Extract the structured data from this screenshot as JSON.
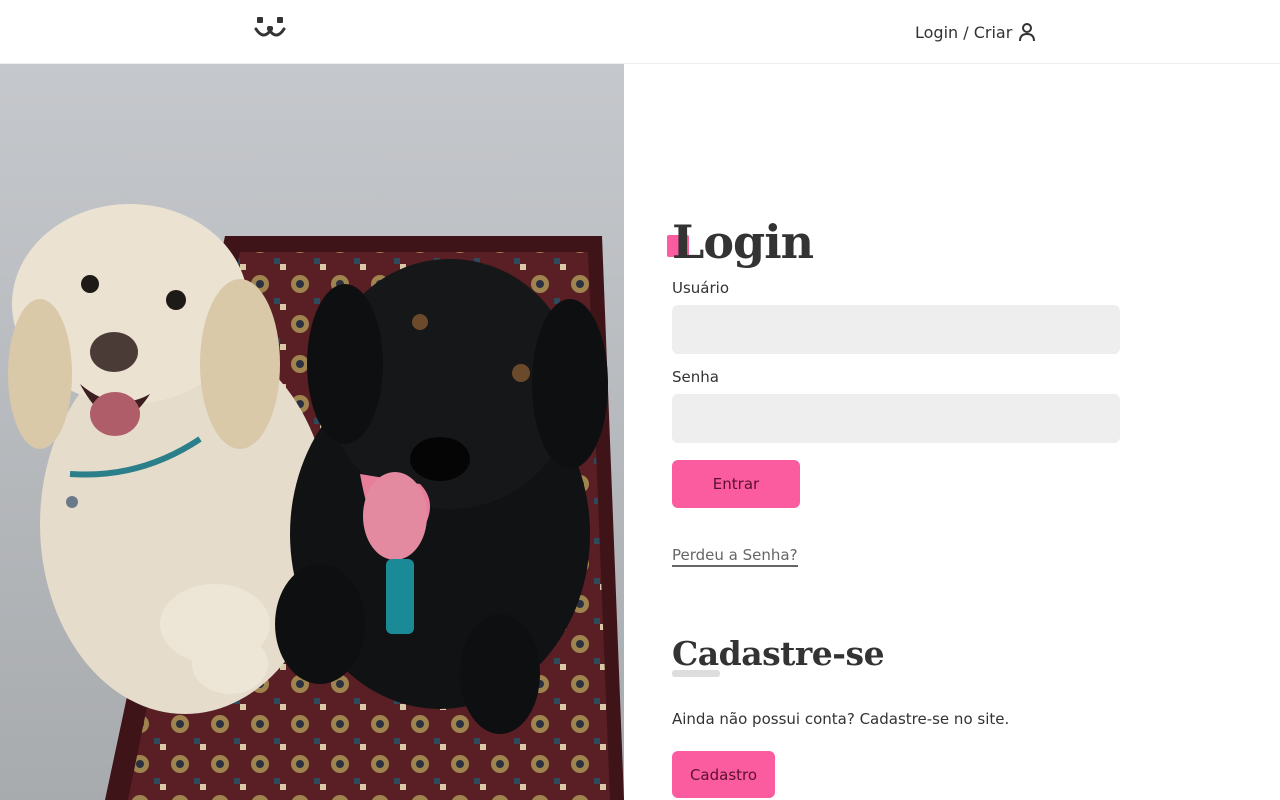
{
  "header": {
    "logo_icon": "dog-face-icon",
    "login_label": "Login / Criar",
    "login_icon": "user-icon"
  },
  "hero": {
    "image_icon": "two-dogs-photo"
  },
  "login": {
    "title": "Login",
    "username_label": "Usuário",
    "username_value": "",
    "password_label": "Senha",
    "password_value": "",
    "submit_label": "Entrar",
    "lost_password_label": "Perdeu a Senha?"
  },
  "signup": {
    "title": "Cadastre-se",
    "description": "Ainda não possui conta? Cadastre-se no site.",
    "button_label": "Cadastro"
  },
  "colors": {
    "accent": "#fb5c9f",
    "input_bg": "#eeeeee",
    "text": "#333333"
  }
}
